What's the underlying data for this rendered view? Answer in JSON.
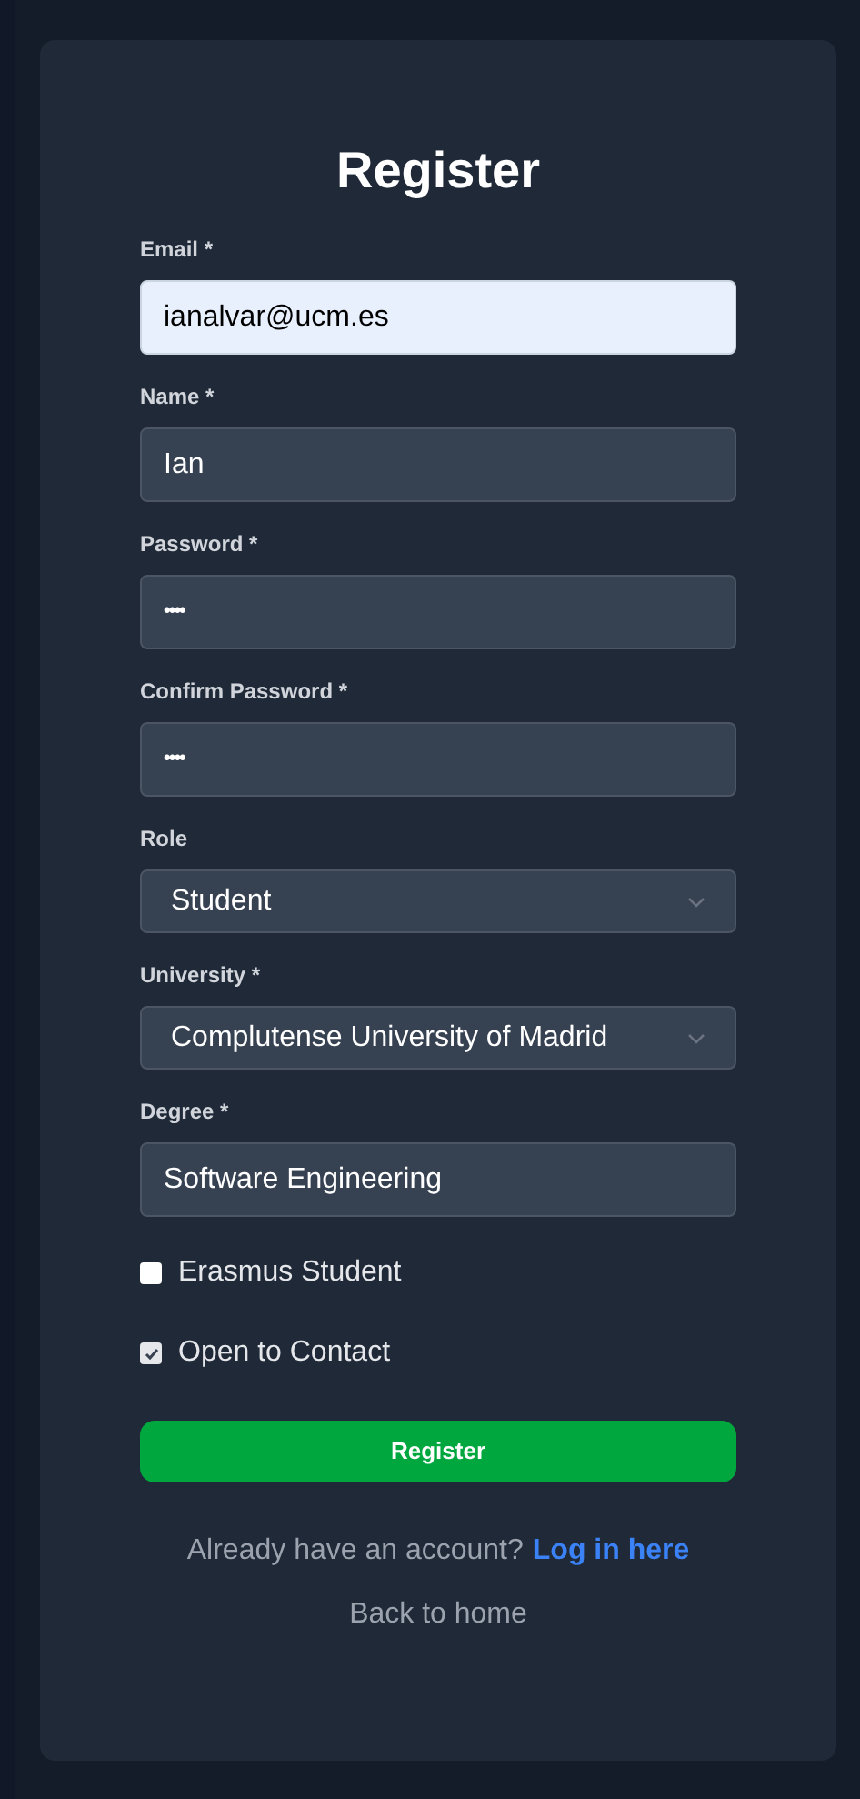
{
  "title": "Register",
  "fields": [
    {
      "kind": "input",
      "label": "Email *",
      "value": "ianalvar@ucm.es",
      "autofilled": true
    },
    {
      "kind": "input",
      "label": "Name *",
      "value": "Ian",
      "autofilled": false
    },
    {
      "kind": "password",
      "label": "Password *",
      "value": "••••",
      "autofilled": false
    },
    {
      "kind": "password",
      "label": "Confirm Password *",
      "value": "••••",
      "autofilled": false
    },
    {
      "kind": "select",
      "label": "Role",
      "value": "Student",
      "autofilled": false
    },
    {
      "kind": "select",
      "label": "University *",
      "value": "Complutense University of Madrid",
      "autofilled": false
    },
    {
      "kind": "input",
      "label": "Degree *",
      "value": "Software Engineering",
      "autofilled": false
    }
  ],
  "checkboxes": [
    {
      "label": "Erasmus Student",
      "checked": false
    },
    {
      "label": "Open to Contact",
      "checked": true
    }
  ],
  "submit": "Register",
  "login_prompt": {
    "text": "Already have an account?",
    "link": "Log in here"
  },
  "back_link": "Back to home"
}
